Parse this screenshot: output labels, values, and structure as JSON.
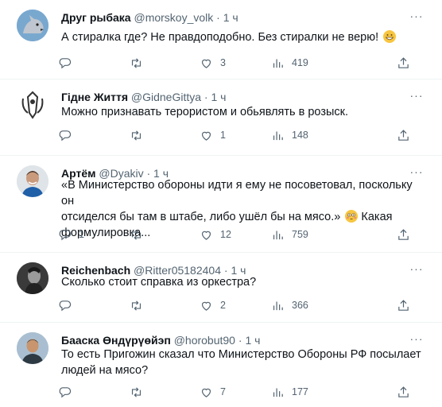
{
  "tweets": [
    {
      "name": "Друг рыбака",
      "handle": "@morskoy_volk",
      "time": "1 ч",
      "dot": "·",
      "lines": [
        "А стиралка где? Не правдоподобно. Без стиралки не верю!"
      ],
      "emoji": "grinning-face-emoji",
      "replies": "",
      "retweets": "",
      "likes": "3",
      "views": "419",
      "more": "···"
    },
    {
      "name": "Гідне Життя",
      "handle": "@GidneGittya",
      "time": "1 ч",
      "dot": "·",
      "lines": [
        "Можно признавать терористом и обьявлять в розыск."
      ],
      "replies": "",
      "retweets": "",
      "likes": "1",
      "views": "148",
      "more": "···"
    },
    {
      "name": "Артём",
      "handle": "@Dyakiv",
      "time": "1 ч",
      "dot": "·",
      "lines": [
        "«В Министерство обороны идти я ему не посоветовал, поскольку он",
        "отсиделся бы там в штабе, либо ушёл бы на мясо.»",
        "Какая",
        "формулировка..."
      ],
      "emoji": "flushed-face-emoji",
      "replies": "1",
      "retweets": "",
      "likes": "12",
      "views": "759",
      "more": "···"
    },
    {
      "name": "Reichenbach",
      "handle": "@Ritter05182404",
      "time": "1 ч",
      "dot": "·",
      "lines": [
        "Сколько стоит справка из оркестра?"
      ],
      "replies": "",
      "retweets": "",
      "likes": "2",
      "views": "366",
      "more": "···"
    },
    {
      "name": "Бааска Өндүрүөйэп",
      "handle": "@horobut90",
      "time": "1 ч",
      "dot": "·",
      "lines": [
        "То есть Пригожин сказал что Министерство Обороны РФ посылает",
        "людей на мясо?"
      ],
      "replies": "",
      "retweets": "",
      "likes": "7",
      "views": "177",
      "more": "···"
    }
  ],
  "colors": {
    "text": "#0f1419",
    "secondary": "#536471",
    "divider": "#eff3f4"
  }
}
